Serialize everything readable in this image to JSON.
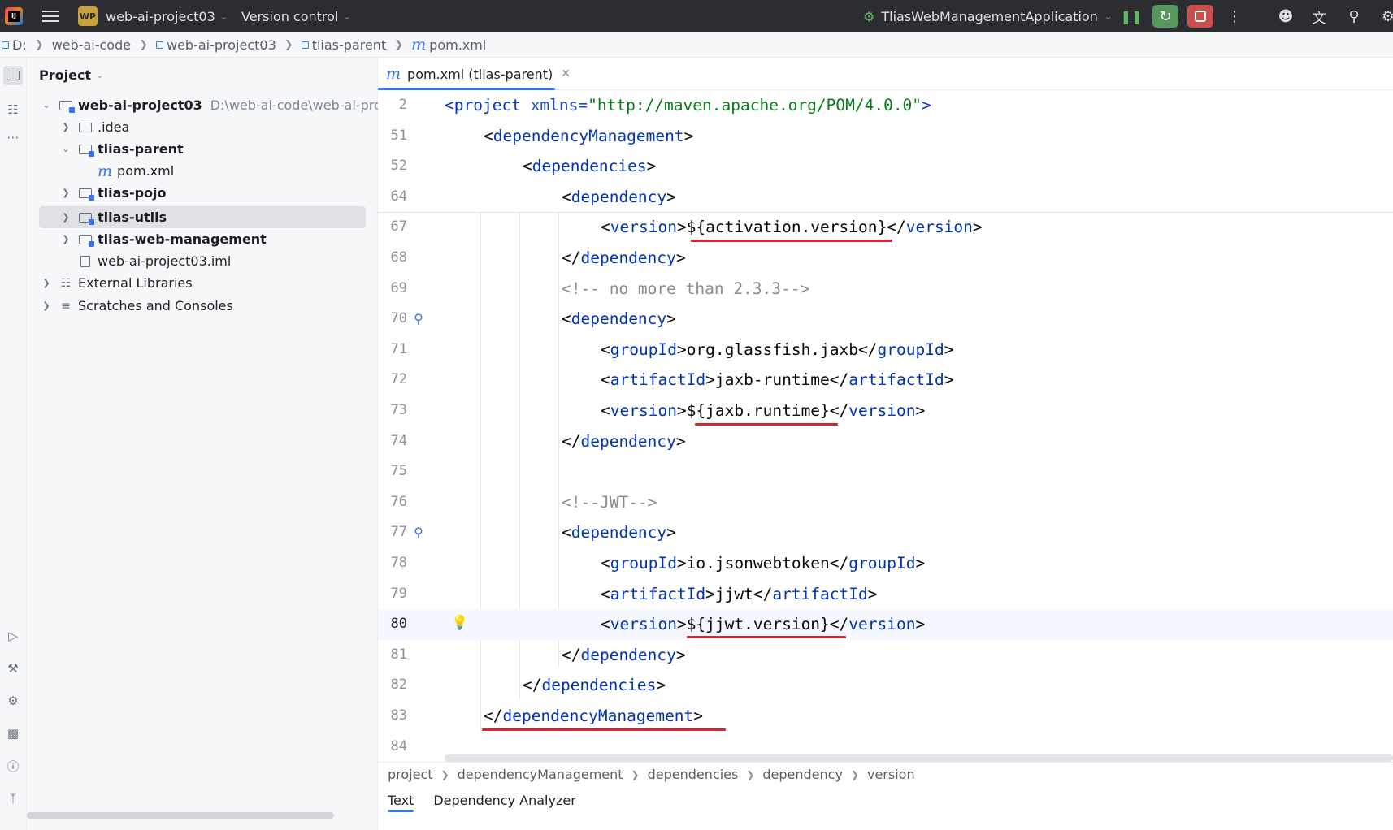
{
  "titlebar": {
    "project_badge": "WP",
    "project_name": "web-ai-project03",
    "vcs_label": "Version control",
    "run_config": "TliasWebManagementApplication"
  },
  "navbar": {
    "crumbs": [
      "D:",
      "web-ai-code",
      "web-ai-project03",
      "tlias-parent",
      "pom.xml"
    ]
  },
  "project_panel": {
    "title": "Project",
    "root": {
      "label": "web-ai-project03",
      "path": "D:\\web-ai-code\\web-ai-proj"
    },
    "items": [
      {
        "label": ".idea"
      },
      {
        "label": "tlias-parent"
      },
      {
        "label": "pom.xml"
      },
      {
        "label": "tlias-pojo"
      },
      {
        "label": "tlias-utils"
      },
      {
        "label": "tlias-web-management"
      },
      {
        "label": "web-ai-project03.iml"
      },
      {
        "label": "External Libraries"
      },
      {
        "label": "Scratches and Consoles"
      }
    ]
  },
  "editor": {
    "tab_label": "pom.xml (tlias-parent)",
    "line_numbers": [
      "2",
      "51",
      "52",
      "64",
      "67",
      "68",
      "69",
      "70",
      "71",
      "72",
      "73",
      "74",
      "75",
      "76",
      "77",
      "78",
      "79",
      "80",
      "81",
      "82",
      "83",
      "84"
    ],
    "project_line": {
      "open": "<",
      "tag": "project",
      "attr": "xmlns",
      "eq": "=",
      "value": "\"http://maven.apache.org/POM/4.0.0\"",
      "close": ">"
    },
    "lines": {
      "l51": {
        "tag": "dependencyManagement"
      },
      "l52": {
        "tag": "dependencies"
      },
      "l64": {
        "tag": "dependency"
      },
      "l67": {
        "tag": "version",
        "value": "${activation.version}"
      },
      "l68": {
        "tag": "dependency"
      },
      "l69": {
        "comment": "<!-- no more than 2.3.3-->"
      },
      "l70": {
        "tag": "dependency"
      },
      "l71": {
        "tag": "groupId",
        "value": "org.glassfish.jaxb"
      },
      "l72": {
        "tag": "artifactId",
        "value": "jaxb-runtime"
      },
      "l73": {
        "tag": "version",
        "value": "${jaxb.runtime}"
      },
      "l74": {
        "tag": "dependency"
      },
      "l76": {
        "comment": "<!--JWT-->"
      },
      "l77": {
        "tag": "dependency"
      },
      "l78": {
        "tag": "groupId",
        "value": "io.jsonwebtoken"
      },
      "l79": {
        "tag": "artifactId",
        "value": "jjwt"
      },
      "l80": {
        "tag": "version",
        "value": "${jjwt.version}"
      },
      "l81": {
        "tag": "dependency"
      },
      "l82": {
        "tag": "dependencies"
      },
      "l83": {
        "tag": "dependencyManagement"
      }
    },
    "breadcrumb": [
      "project",
      "dependencyManagement",
      "dependencies",
      "dependency",
      "version"
    ],
    "bottom_tabs": {
      "text": "Text",
      "analyzer": "Dependency Analyzer"
    }
  },
  "colors": {
    "titlebar_bg": "#2b2d30",
    "accent": "#3574f0",
    "tag": "#0033b3",
    "string": "#067d17",
    "comment": "#8c8c8c",
    "annotation_red": "#e0232b",
    "run_green": "#57965c",
    "stop_red": "#c94f4f"
  },
  "icons": [
    "app-logo-icon",
    "hamburger-menu-icon",
    "chevron-down-icon",
    "run-config-icon",
    "pause-icon",
    "rerun-icon",
    "stop-icon",
    "more-icon",
    "user-icon",
    "translate-icon",
    "search-icon",
    "settings-icon",
    "folder-icon",
    "module-icon",
    "maven-icon",
    "library-icon",
    "scratch-icon",
    "bean-gutter-icon",
    "lightbulb-icon"
  ]
}
